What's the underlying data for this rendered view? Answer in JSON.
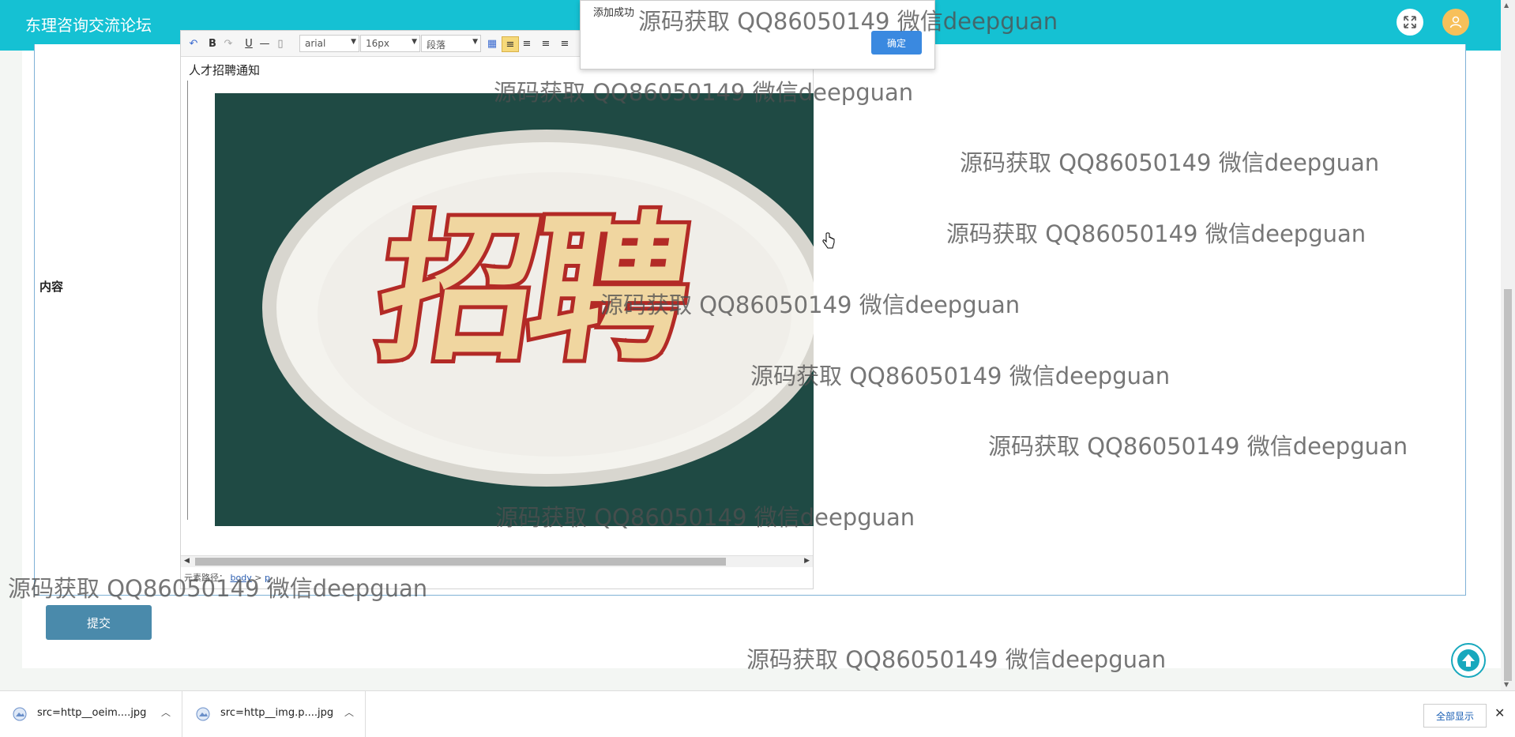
{
  "app": {
    "title": "东理咨询交流论坛"
  },
  "header": {
    "fullscreen_icon": "expand-icon",
    "user_icon": "user-avatar-icon"
  },
  "form": {
    "content_label": "内容",
    "submit_label": "提交"
  },
  "editor": {
    "toolbar": {
      "font_family": "arial",
      "font_size": "16px",
      "paragraph": "段落",
      "bold": "B",
      "underline": "U"
    },
    "doc_title": "人才招聘通知",
    "image": {
      "text": "招聘",
      "colors": {
        "background": "#1f4a44",
        "ring": "#f1f0ea",
        "letters": "#c8322b"
      }
    },
    "element_path_label": "元素路径：",
    "element_path_links": [
      "body",
      "p"
    ]
  },
  "alert": {
    "message": "添加成功",
    "ok_label": "确定"
  },
  "watermark": {
    "text": "源码获取 QQ86050149 微信deepguan"
  },
  "downloads": {
    "items": [
      {
        "name": "src=http__oeim....jpg"
      },
      {
        "name": "src=http__img.p....jpg"
      }
    ],
    "show_all": "全部显示"
  },
  "colors": {
    "header": "#15c1d3",
    "submit": "#4a8aab",
    "ok_button": "#3a89e0"
  }
}
